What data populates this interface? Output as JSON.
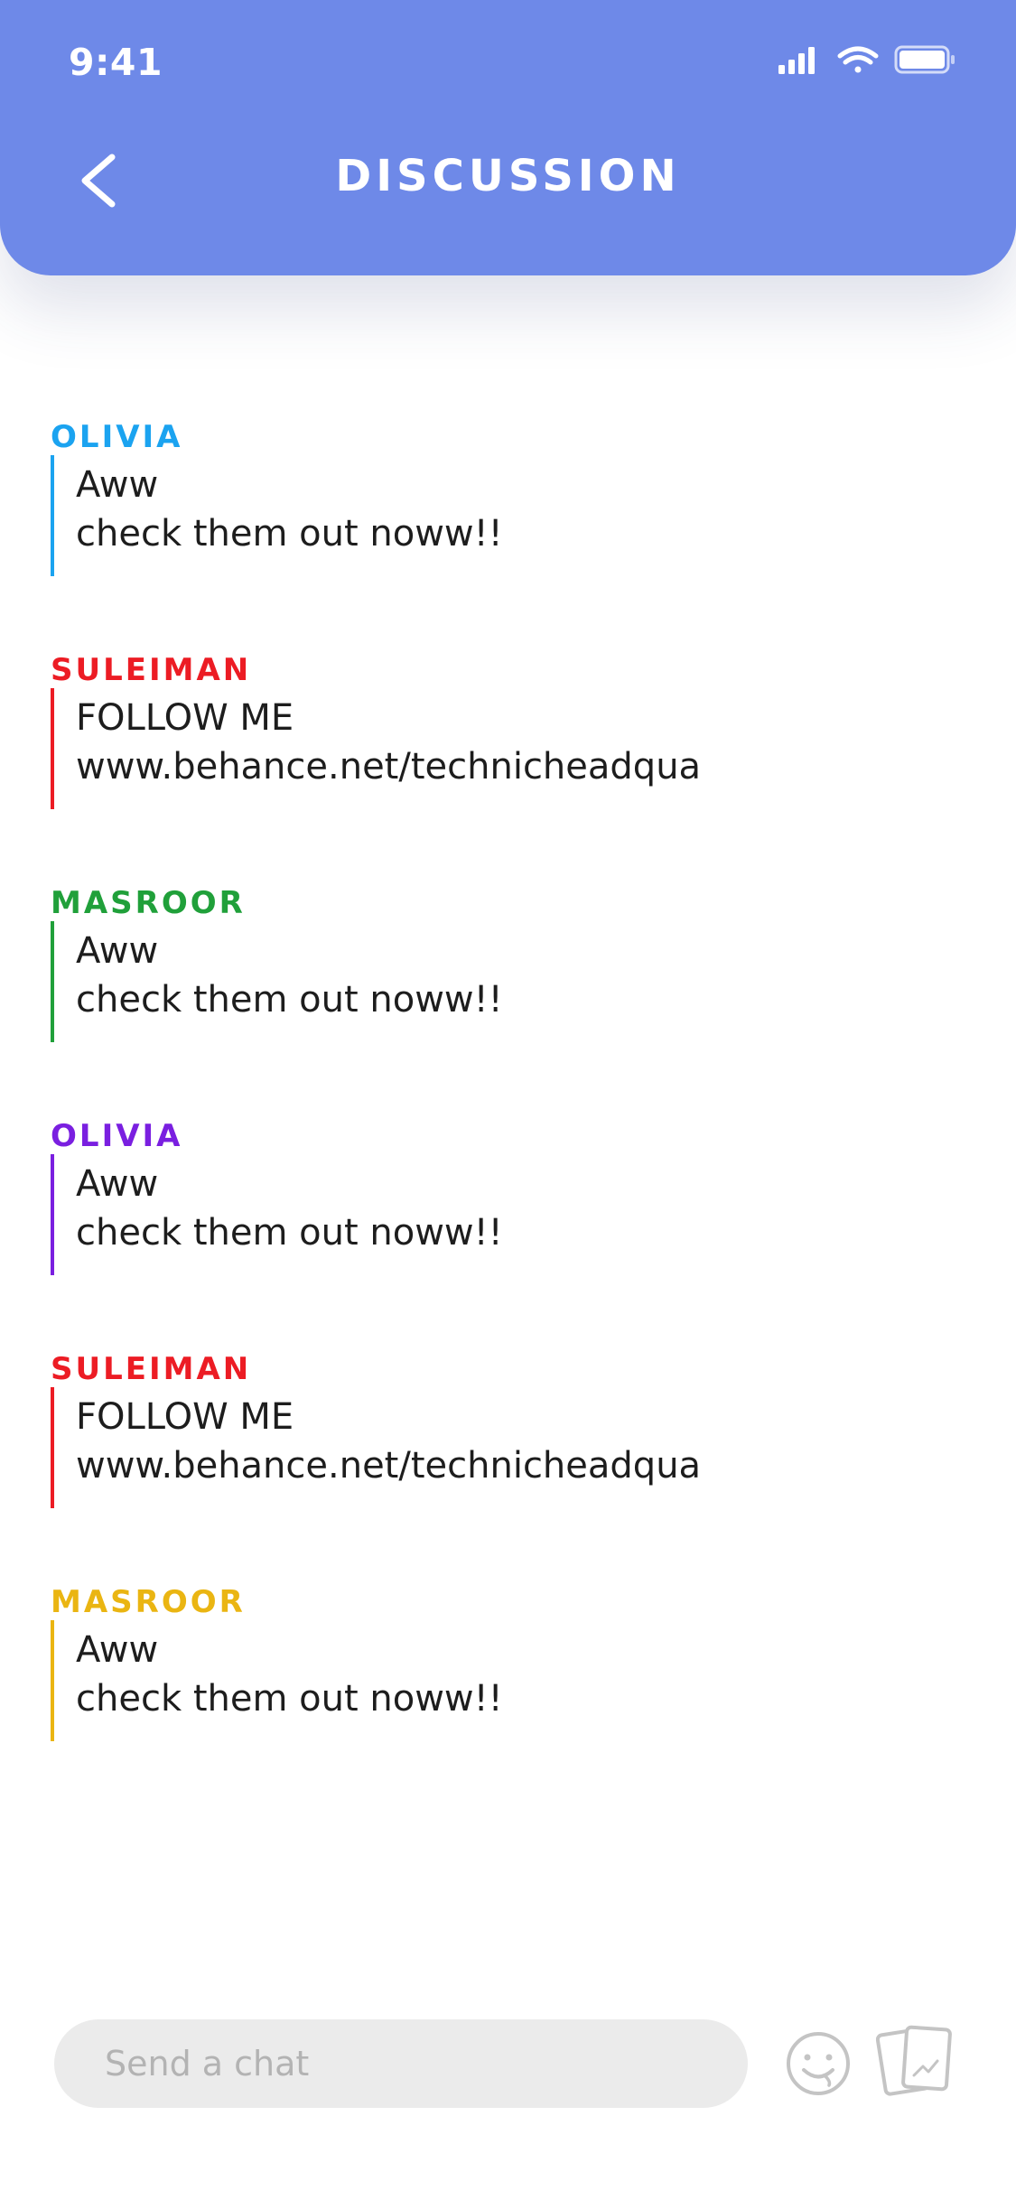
{
  "status_bar": {
    "time": "9:41"
  },
  "header": {
    "title": "DISCUSSION",
    "background_color": "#6e89e8"
  },
  "messages": [
    {
      "author": "OLIVIA",
      "color": "#1ba3f0",
      "lines": [
        "Aww",
        "check them out noww!!"
      ]
    },
    {
      "author": "SULEIMAN",
      "color": "#ec1c24",
      "lines": [
        "FOLLOW ME",
        "www.behance.net/technicheadqua"
      ]
    },
    {
      "author": "MASROOR",
      "color": "#20a03a",
      "lines": [
        "Aww",
        "check them out noww!!"
      ]
    },
    {
      "author": "OLIVIA",
      "color": "#7a1fe0",
      "lines": [
        "Aww",
        "check them out noww!!"
      ]
    },
    {
      "author": "SULEIMAN",
      "color": "#ec1c24",
      "lines": [
        "FOLLOW ME",
        "www.behance.net/technicheadqua"
      ]
    },
    {
      "author": "MASROOR",
      "color": "#eab512",
      "lines": [
        "Aww",
        "check them out noww!!"
      ]
    }
  ],
  "composer": {
    "placeholder": "Send a chat",
    "value": ""
  },
  "icons": {
    "back": "chevron-left-icon",
    "emoji": "emoji-face-icon",
    "cards": "cards-icon",
    "signal": "cellular-signal-icon",
    "wifi": "wifi-icon",
    "battery": "battery-icon"
  }
}
